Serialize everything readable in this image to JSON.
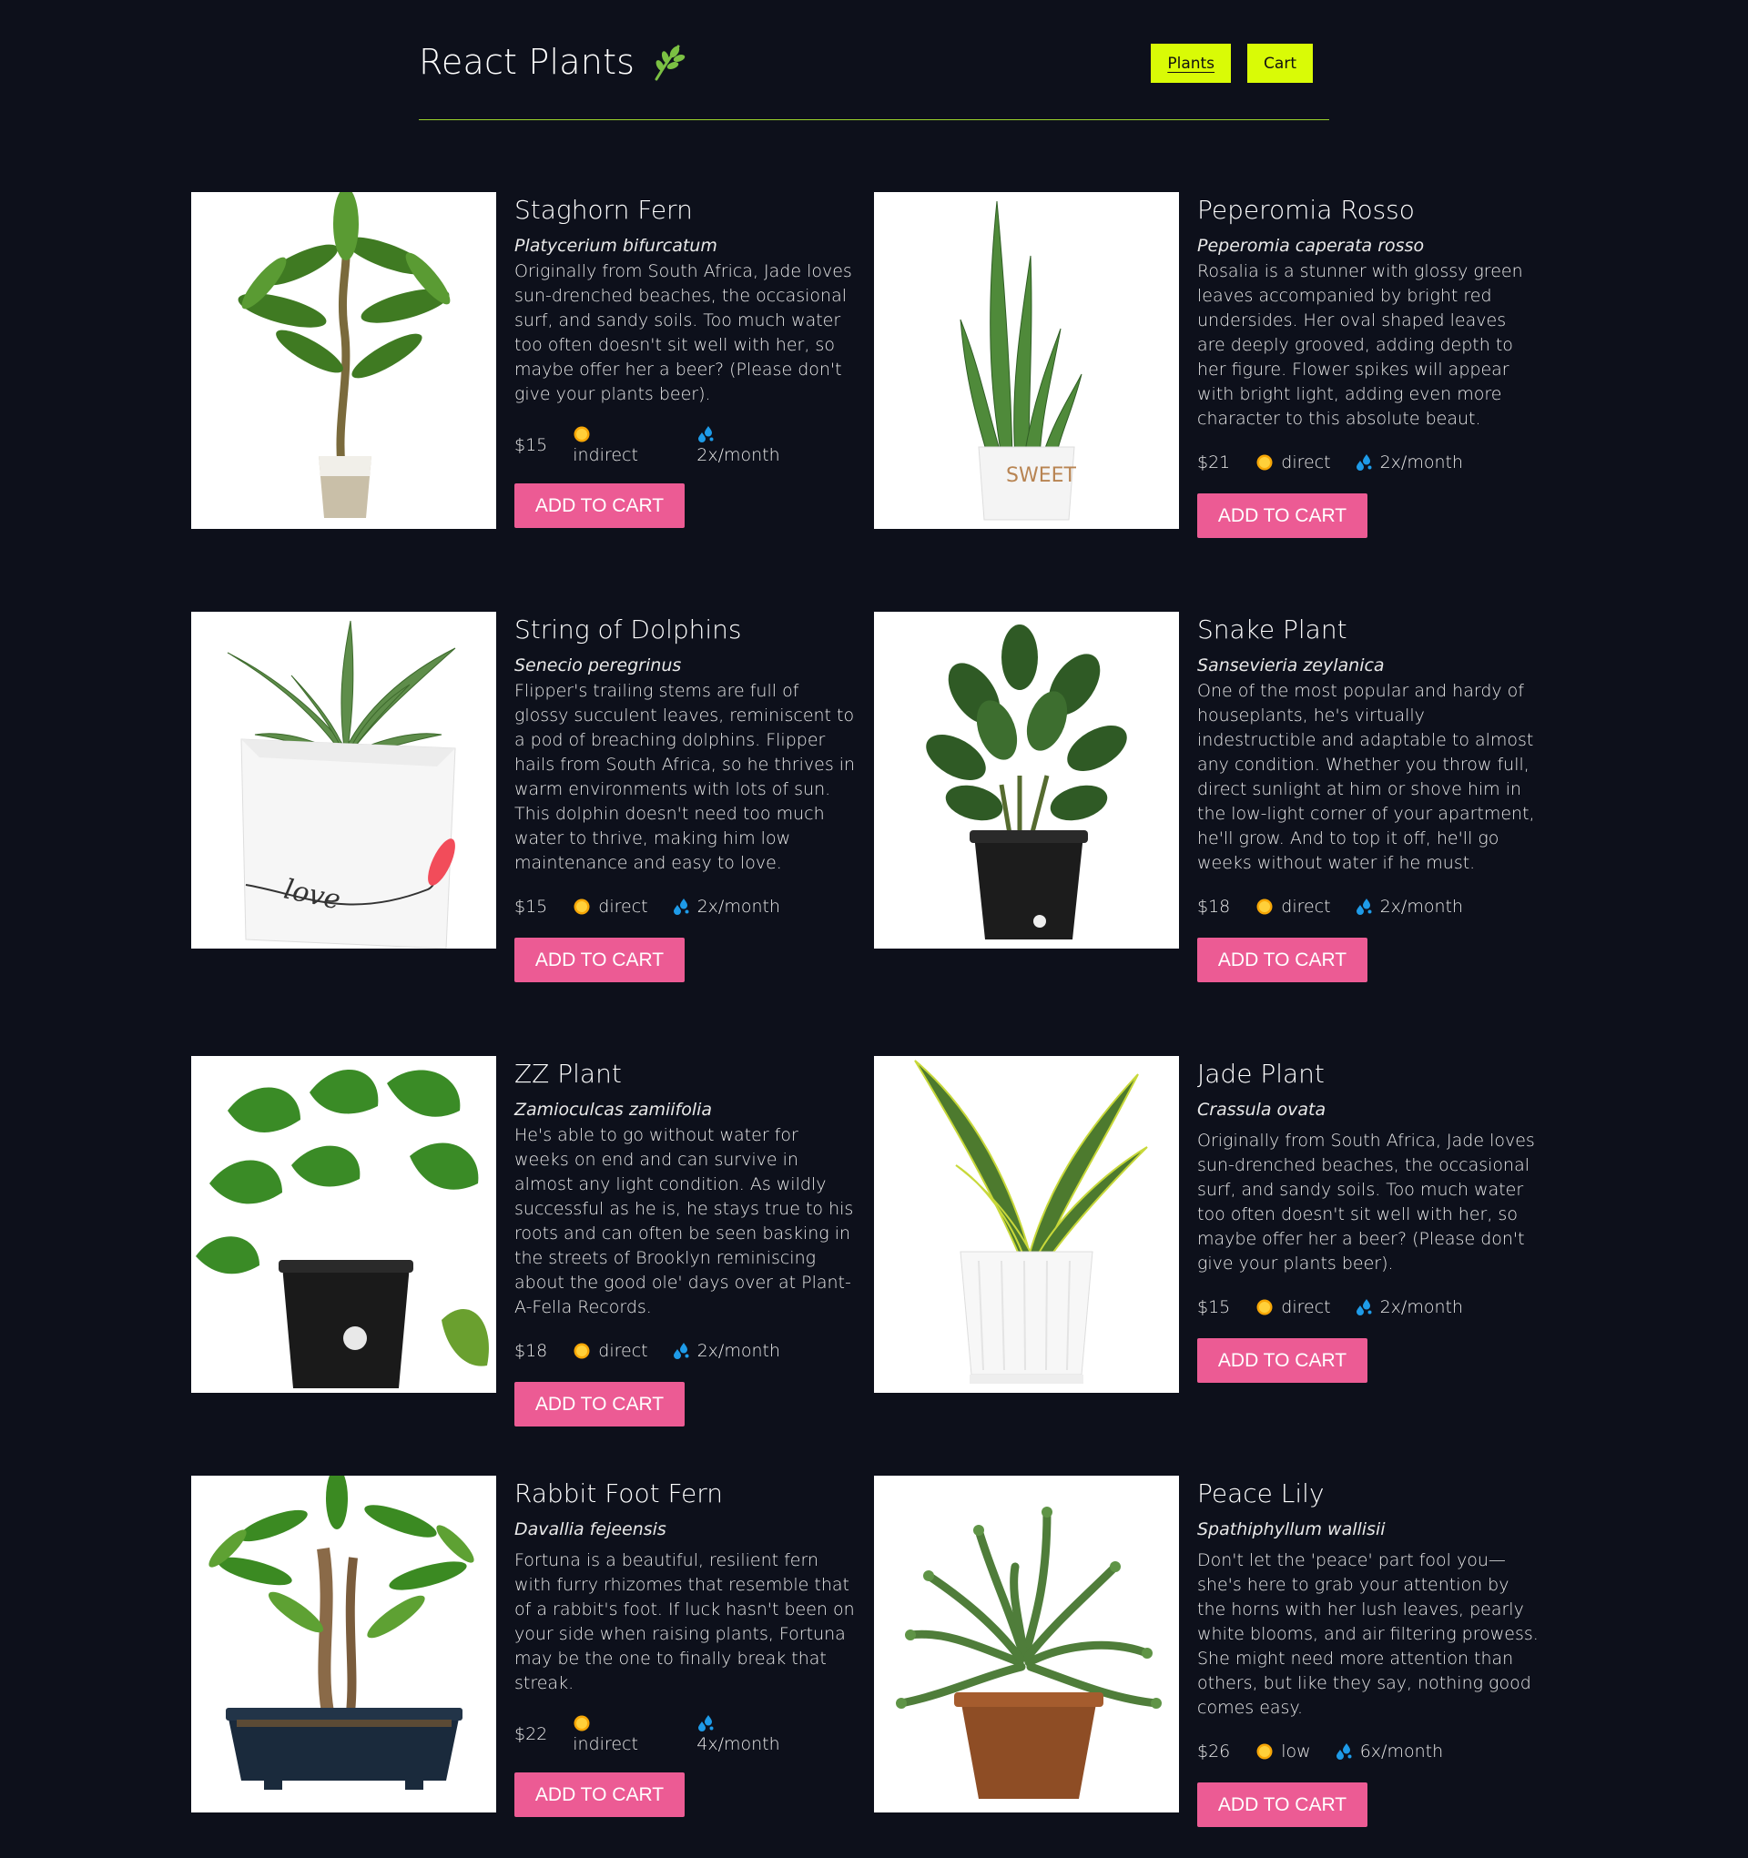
{
  "header": {
    "title": "React Plants",
    "nav": [
      {
        "label": "Plants",
        "active": true
      },
      {
        "label": "Cart",
        "active": false
      }
    ]
  },
  "colors": {
    "background": "#0d101b",
    "accent": "#d9fb06",
    "button": "#ec5b94",
    "divider": "#9ad22b"
  },
  "plants": [
    {
      "name": "Staghorn Fern",
      "scientific": "Platycerium bifurcatum",
      "description": "Originally from South Africa, Jade loves sun-drenched beaches, the occasional surf, and sandy soils. Too much water too often doesn't sit well with her, so maybe offer her a beer? (Please don't give your plants beer).",
      "price": "$15",
      "light": "indirect",
      "water": "2x/month",
      "button": "ADD TO CART",
      "image": "money-tree-white-pot"
    },
    {
      "name": "Peperomia Rosso",
      "scientific": "Peperomia caperata rosso",
      "description": "Rosalia is a stunner with glossy green leaves accompanied by bright red undersides. Her oval shaped leaves are deeply grooved, adding depth to her figure. Flower spikes will appear with bright light, adding even more character to this absolute beaut.",
      "price": "$21",
      "light": "direct",
      "water": "2x/month",
      "button": "ADD TO CART",
      "image": "snake-plant-sweet-home-pot"
    },
    {
      "name": "String of Dolphins",
      "scientific": "Senecio peregrinus",
      "description": "Flipper's trailing stems are full of glossy succulent leaves, reminiscent to a pod of breaching dolphins. Flipper hails from South Africa, so he thrives in warm environments with lots of sun. This dolphin doesn't need too much water to thrive, making him low maintenance and easy to love.",
      "price": "$15",
      "light": "direct",
      "water": "2x/month",
      "button": "ADD TO CART",
      "image": "aloe-love-pot",
      "pot_text": "love"
    },
    {
      "name": "Snake Plant",
      "scientific": "Sansevieria zeylanica",
      "description": "One of the most popular and hardy of houseplants, he's virtually indestructible and adaptable to almost any condition. Whether you throw full, direct sunlight at him or shove him in the low-light corner of your apartment, he'll grow. And to top it off, he'll go weeks without water if he must.",
      "price": "$18",
      "light": "direct",
      "water": "2x/month",
      "button": "ADD TO CART",
      "image": "zz-plant-black-pot"
    },
    {
      "name": "ZZ Plant",
      "scientific": "Zamioculcas zamiifolia",
      "description": "He's able to go without water for weeks on end and can survive in almost any light condition. As wildly successful as he is, he stays true to his roots and can often be seen basking in the streets of Brooklyn reminiscing about the good ole' days over at Plant-A-Fella Records.",
      "price": "$18",
      "light": "direct",
      "water": "2x/month",
      "button": "ADD TO CART",
      "image": "pothos-black-pot"
    },
    {
      "name": "Jade Plant",
      "scientific": "Crassula ovata",
      "description": "Originally from South Africa, Jade loves sun-drenched beaches, the occasional surf, and sandy soils. Too much water too often doesn't sit well with her, so maybe offer her a beer? (Please don't give your plants beer).",
      "price": "$15",
      "light": "direct",
      "water": "2x/month",
      "button": "ADD TO CART",
      "image": "sansevieria-white-pot"
    },
    {
      "name": "Rabbit Foot Fern",
      "scientific": "Davallia fejeensis",
      "description": "Fortuna is a beautiful, resilient fern with furry rhizomes that resemble that of a rabbit's foot. If luck hasn't been on your side when raising plants, Fortuna may be the one to finally break that streak.",
      "price": "$22",
      "light": "indirect",
      "water": "4x/month",
      "button": "ADD TO CART",
      "image": "money-tree-bonsai"
    },
    {
      "name": "Peace Lily",
      "scientific": "Spathiphyllum wallisii",
      "description": "Don't let the 'peace' part fool you—she's here to grab your attention by the horns with her lush leaves, pearly white blooms, and air filtering prowess. She might need more attention than others, but like they say, nothing good comes easy.",
      "price": "$26",
      "light": "low",
      "water": "6x/month",
      "button": "ADD TO CART",
      "image": "string-of-dolphins-terracotta"
    }
  ]
}
